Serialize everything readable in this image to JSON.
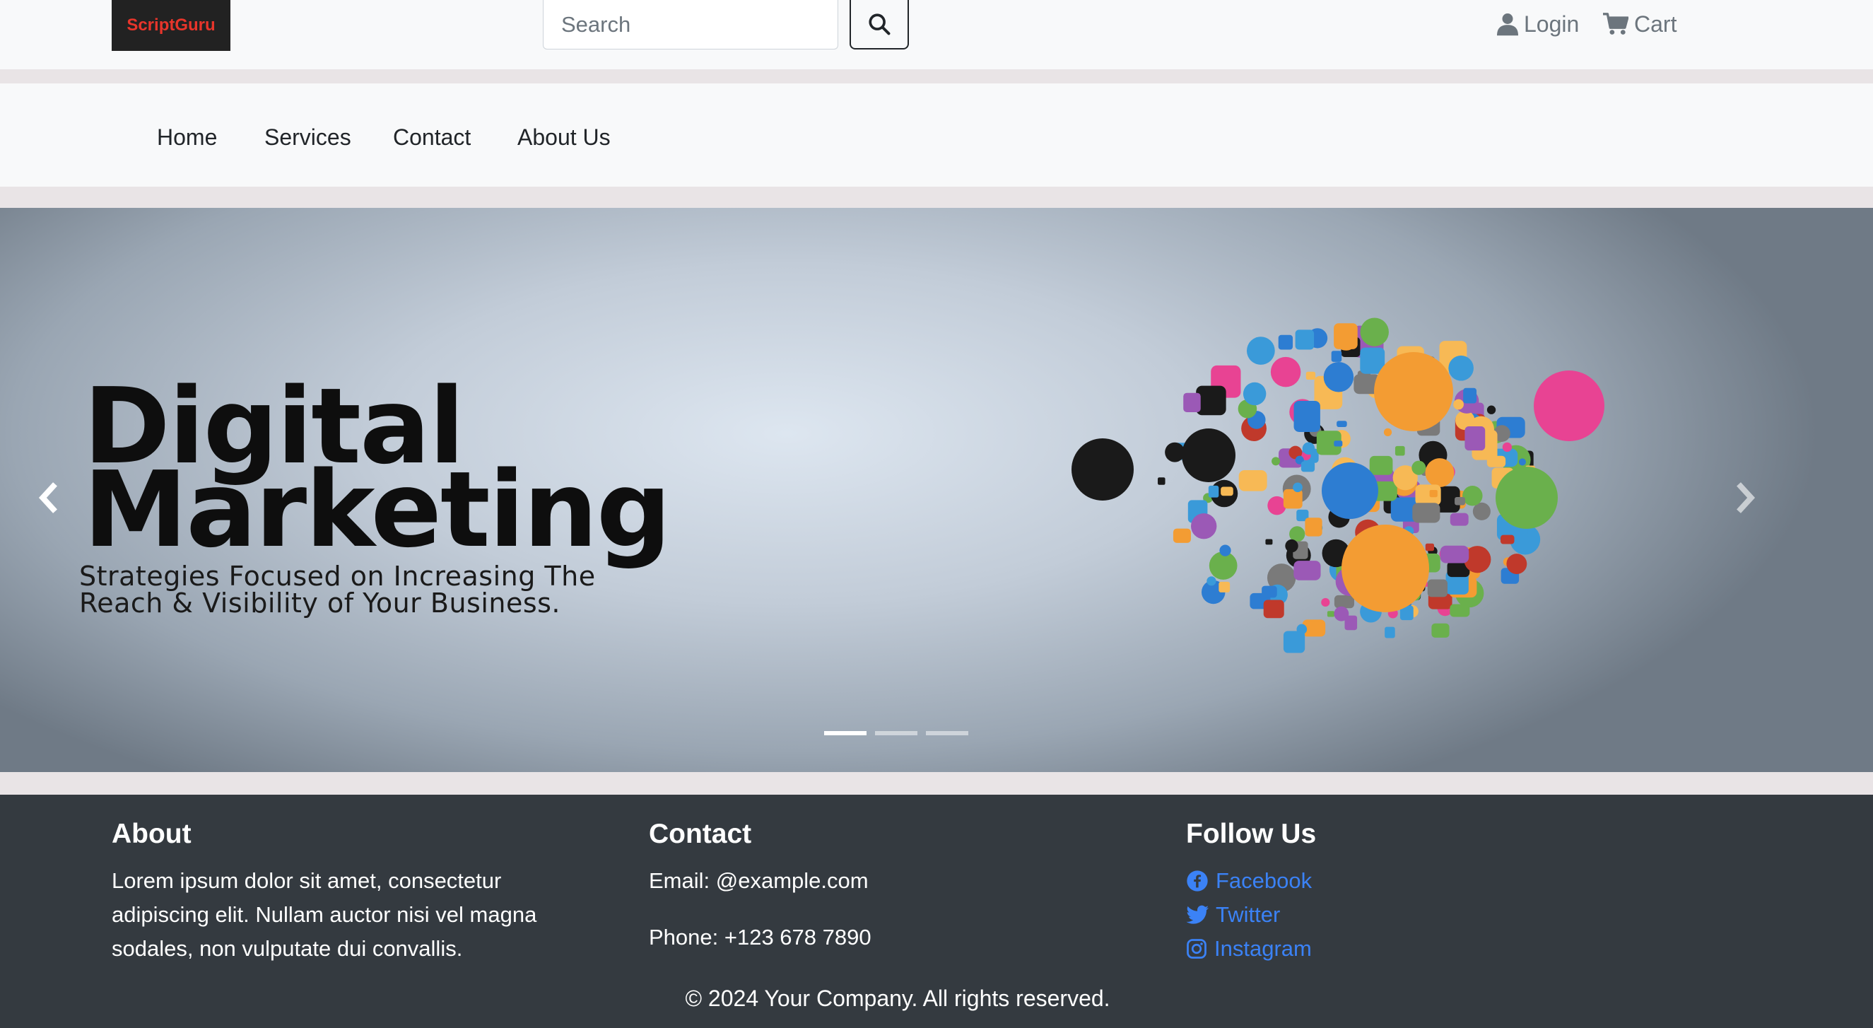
{
  "header": {
    "logo_text": "ScriptGuru",
    "search_placeholder": "Search",
    "search_icon": "search-icon",
    "login_label": "Login",
    "cart_label": "Cart"
  },
  "nav": {
    "items": [
      {
        "label": "Home"
      },
      {
        "label": "Services"
      },
      {
        "label": "Contact"
      },
      {
        "label": "About Us"
      }
    ]
  },
  "carousel": {
    "slide_title_line1": "Digital",
    "slide_title_line2": "Marketing",
    "slide_subtitle_line1": "Strategies Focused on Increasing The",
    "slide_subtitle_line2": "Reach & Visibility of Your Business.",
    "active_index": 0,
    "indicator_count": 3
  },
  "footer": {
    "about": {
      "title": "About",
      "text": "Lorem ipsum dolor sit amet, consectetur adipiscing elit. Nullam auctor nisi vel magna sodales, non vulputate dui convallis."
    },
    "contact": {
      "title": "Contact",
      "email": "Email: @example.com",
      "phone": "Phone: +123 678 7890"
    },
    "follow": {
      "title": "Follow Us",
      "links": [
        {
          "label": "Facebook",
          "icon": "facebook-icon"
        },
        {
          "label": "Twitter",
          "icon": "twitter-icon"
        },
        {
          "label": "Instagram",
          "icon": "instagram-icon"
        }
      ]
    },
    "copyright": "© 2024 Your Company. All rights reserved."
  },
  "colors": {
    "logo_text": "#e8352b",
    "link_blue": "#3b82f6",
    "footer_bg": "#343a40"
  }
}
